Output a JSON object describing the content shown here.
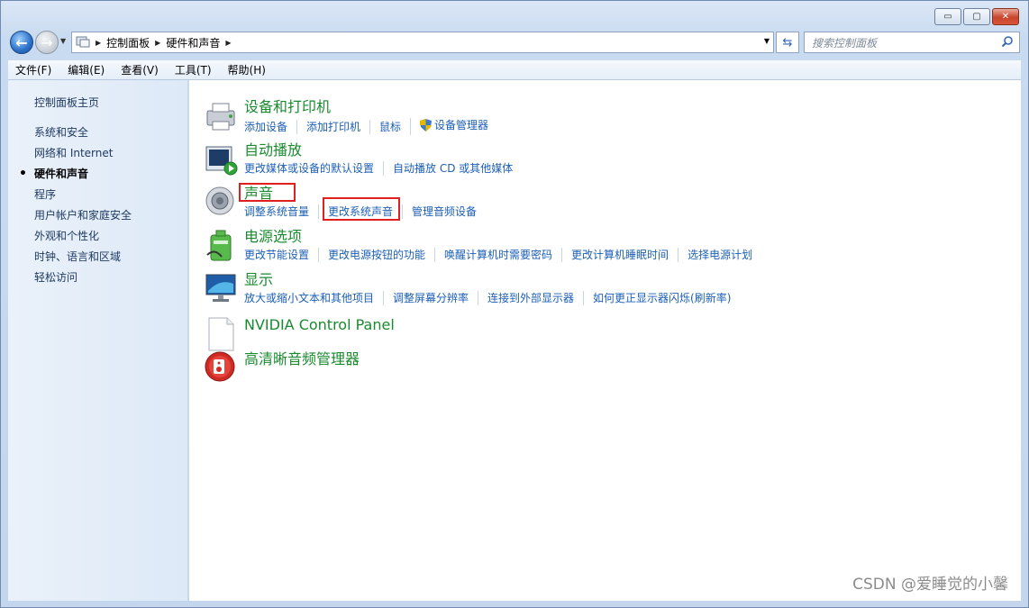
{
  "window": {
    "minimize": "▭",
    "maximize": "▢",
    "close": "✕"
  },
  "nav": {
    "back": "←",
    "forward": "→"
  },
  "address": {
    "crumbs": [
      "控制面板",
      "硬件和声音"
    ]
  },
  "search": {
    "placeholder": "搜索控制面板"
  },
  "menubar": [
    "文件(F)",
    "编辑(E)",
    "查看(V)",
    "工具(T)",
    "帮助(H)"
  ],
  "sidebar": {
    "home": "控制面板主页",
    "items": [
      {
        "label": "系统和安全"
      },
      {
        "label": "网络和 Internet"
      },
      {
        "label": "硬件和声音",
        "active": true
      },
      {
        "label": "程序"
      },
      {
        "label": "用户帐户和家庭安全"
      },
      {
        "label": "外观和个性化"
      },
      {
        "label": "时钟、语言和区域"
      },
      {
        "label": "轻松访问"
      }
    ]
  },
  "categories": [
    {
      "title": "设备和打印机",
      "icon": "printer-icon",
      "links": [
        "添加设备",
        "添加打印机",
        "鼠标",
        "设备管理器"
      ]
    },
    {
      "title": "自动播放",
      "icon": "autoplay-icon",
      "links": [
        "更改媒体或设备的默认设置",
        "自动播放 CD 或其他媒体"
      ]
    },
    {
      "title": "声音",
      "icon": "speaker-icon",
      "links": [
        "调整系统音量",
        "更改系统声音",
        "管理音频设备"
      ]
    },
    {
      "title": "电源选项",
      "icon": "power-icon",
      "links": [
        "更改节能设置",
        "更改电源按钮的功能",
        "唤醒计算机时需要密码",
        "更改计算机睡眠时间",
        "选择电源计划"
      ]
    },
    {
      "title": "显示",
      "icon": "display-icon",
      "links": [
        "放大或缩小文本和其他项目",
        "调整屏幕分辨率",
        "连接到外部显示器",
        "如何更正显示器闪烁(刷新率)"
      ]
    },
    {
      "title": "NVIDIA Control Panel",
      "icon": "document-icon",
      "links": []
    },
    {
      "title": "高清晰音频管理器",
      "icon": "audio-manager-icon",
      "links": []
    }
  ],
  "watermark": "CSDN @爱睡觉的小馨",
  "colors": {
    "link": "#1c5fb6",
    "title": "#1a8a2f",
    "highlight": "#e02020"
  }
}
